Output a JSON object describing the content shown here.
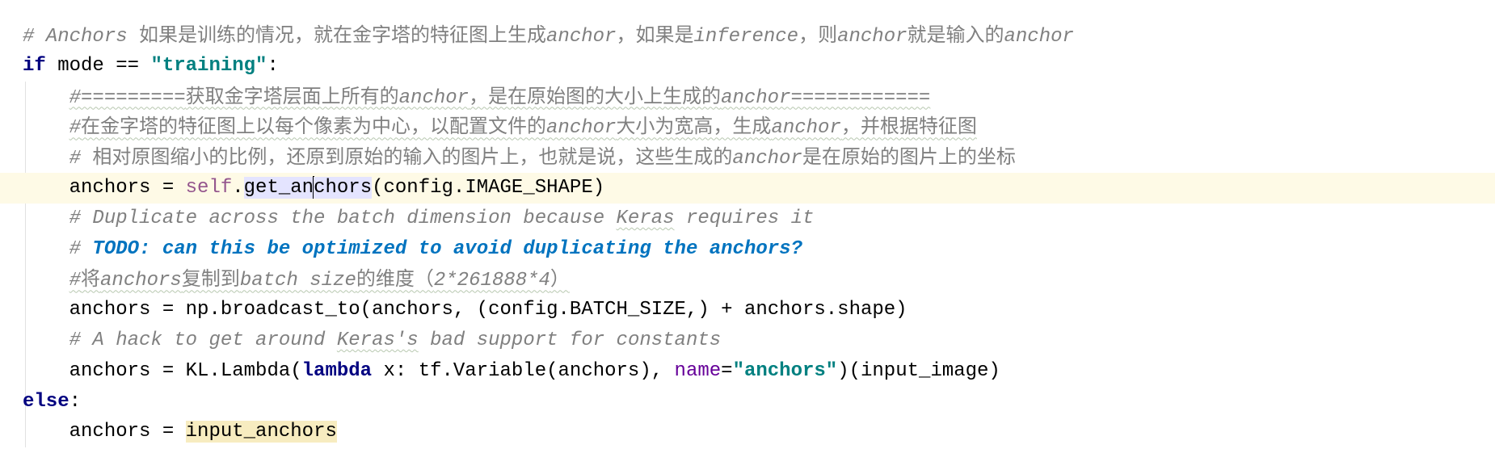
{
  "colors": {
    "comment": "#808080",
    "keyword": "#000080",
    "string": "#008080",
    "self": "#94558D",
    "param": "#660099",
    "todo": "#0073BF",
    "current_line": "#FEFAE6",
    "usage_highlight": "#E4E4FF",
    "read_highlight": "#F7ECC0"
  },
  "lines": [
    {
      "indent": 0,
      "tokens": [
        {
          "t": "# Anchors ",
          "c": "cm"
        },
        {
          "t": "如果是训练的情况，就在金字塔的特征图上生成",
          "c": "cm-cjk"
        },
        {
          "t": "anchor",
          "c": "cm"
        },
        {
          "t": "，如果是",
          "c": "cm-cjk"
        },
        {
          "t": "inference",
          "c": "cm"
        },
        {
          "t": "，则",
          "c": "cm-cjk"
        },
        {
          "t": "anchor",
          "c": "cm"
        },
        {
          "t": "就是输入的",
          "c": "cm-cjk"
        },
        {
          "t": "anchor",
          "c": "cm"
        }
      ]
    },
    {
      "indent": 0,
      "tokens": [
        {
          "t": "if",
          "c": "kw"
        },
        {
          "t": " mode == ",
          "c": ""
        },
        {
          "t": "\"training\"",
          "c": "str"
        },
        {
          "t": ":",
          "c": ""
        }
      ]
    },
    {
      "indent": 1,
      "tokens": [
        {
          "t": "#=========",
          "c": "cm squiggle"
        },
        {
          "t": "获取金字塔层面上所有的",
          "c": "cm-cjk squiggle"
        },
        {
          "t": "anchor",
          "c": "cm squiggle"
        },
        {
          "t": "，是在原始图的大小上生成的",
          "c": "cm-cjk squiggle"
        },
        {
          "t": "anchor============",
          "c": "cm squiggle"
        }
      ]
    },
    {
      "indent": 1,
      "tokens": [
        {
          "t": "#",
          "c": "cm squiggle"
        },
        {
          "t": "在金字塔的特征图上以每个像素为中心，以配置文件的",
          "c": "cm-cjk squiggle"
        },
        {
          "t": "anchor",
          "c": "cm squiggle"
        },
        {
          "t": "大小为宽高，生成",
          "c": "cm-cjk squiggle"
        },
        {
          "t": "anchor",
          "c": "cm squiggle"
        },
        {
          "t": "，并根据特征图",
          "c": "cm-cjk squiggle"
        }
      ]
    },
    {
      "indent": 1,
      "tokens": [
        {
          "t": "# ",
          "c": "cm"
        },
        {
          "t": "相对原图缩小的比例，还原到原始的输入的图片上，也就是说，这些生成的",
          "c": "cm-cjk"
        },
        {
          "t": "anchor",
          "c": "cm"
        },
        {
          "t": "是在原始的图片上的坐标",
          "c": "cm-cjk"
        }
      ]
    },
    {
      "indent": 1,
      "current": true,
      "tokens": [
        {
          "t": "anchors = ",
          "c": ""
        },
        {
          "t": "self",
          "c": "self"
        },
        {
          "t": ".",
          "c": ""
        },
        {
          "t": "get_an",
          "c": "usage"
        },
        {
          "t": "",
          "c": "caret"
        },
        {
          "t": "chors",
          "c": "usage"
        },
        {
          "t": "(config.IMAGE_SHAPE)",
          "c": ""
        }
      ]
    },
    {
      "indent": 1,
      "tokens": [
        {
          "t": "# Duplicate across the batch dimension because ",
          "c": "cm"
        },
        {
          "t": "Keras",
          "c": "cm squiggle"
        },
        {
          "t": " requires it",
          "c": "cm"
        }
      ]
    },
    {
      "indent": 1,
      "tokens": [
        {
          "t": "# ",
          "c": "cm"
        },
        {
          "t": "TODO: can this be optimized to avoid duplicating the anchors?",
          "c": "todo"
        }
      ]
    },
    {
      "indent": 1,
      "tokens": [
        {
          "t": "#",
          "c": "cm squiggle"
        },
        {
          "t": "将",
          "c": "cm-cjk squiggle"
        },
        {
          "t": "anchors",
          "c": "cm squiggle"
        },
        {
          "t": "复制到",
          "c": "cm-cjk squiggle"
        },
        {
          "t": "batch size",
          "c": "cm squiggle"
        },
        {
          "t": "的维度（",
          "c": "cm-cjk squiggle"
        },
        {
          "t": "2*261888*4",
          "c": "cm squiggle"
        },
        {
          "t": "）",
          "c": "cm-cjk squiggle"
        }
      ]
    },
    {
      "indent": 1,
      "tokens": [
        {
          "t": "anchors = np.broadcast_to(anchors, (config.BATCH_SIZE,) + anchors.shape)",
          "c": ""
        }
      ]
    },
    {
      "indent": 1,
      "tokens": [
        {
          "t": "# A hack to get around ",
          "c": "cm"
        },
        {
          "t": "Keras's",
          "c": "cm squiggle"
        },
        {
          "t": " bad support for constants",
          "c": "cm"
        }
      ]
    },
    {
      "indent": 1,
      "tokens": [
        {
          "t": "anchors = KL.Lambda(",
          "c": ""
        },
        {
          "t": "lambda",
          "c": "kw"
        },
        {
          "t": " x: tf.Variable(anchors), ",
          "c": ""
        },
        {
          "t": "name",
          "c": "param"
        },
        {
          "t": "=",
          "c": ""
        },
        {
          "t": "\"anchors\"",
          "c": "str"
        },
        {
          "t": ")(input_image)",
          "c": ""
        }
      ]
    },
    {
      "indent": 0,
      "tokens": [
        {
          "t": "else",
          "c": "kw"
        },
        {
          "t": ":",
          "c": ""
        }
      ]
    },
    {
      "indent": 1,
      "tokens": [
        {
          "t": "anchors = ",
          "c": ""
        },
        {
          "t": "input_anchors",
          "c": "readhl"
        }
      ]
    }
  ]
}
